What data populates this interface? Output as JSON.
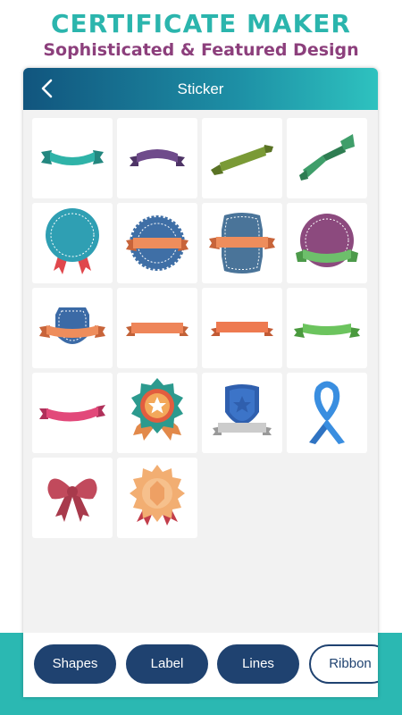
{
  "promo": {
    "title": "CERTIFICATE MAKER",
    "subtitle": "Sophisticated & Featured Design"
  },
  "appbar": {
    "title": "Sticker",
    "back_icon": "chevron-left-icon"
  },
  "stickers": [
    {
      "name": "ribbon-banner-teal-sticker",
      "colors": [
        "#2fb3a8"
      ]
    },
    {
      "name": "ribbon-banner-purple-sticker",
      "colors": [
        "#6f4b8b"
      ]
    },
    {
      "name": "ribbon-banner-olive-sticker",
      "colors": [
        "#7a9a36"
      ]
    },
    {
      "name": "ribbon-zigzag-green-sticker",
      "colors": [
        "#3f9e6a"
      ]
    },
    {
      "name": "badge-teal-ribbon-sticker",
      "colors": [
        "#2f9fb3",
        "#e0474c"
      ]
    },
    {
      "name": "seal-blue-orange-banner-sticker",
      "colors": [
        "#3f6fa6",
        "#ee8d5c"
      ]
    },
    {
      "name": "label-slate-orange-banner-sticker",
      "colors": [
        "#4a7499",
        "#ee8d5c"
      ]
    },
    {
      "name": "circle-purple-green-banner-sticker",
      "colors": [
        "#8c4a7e",
        "#6dbf6b"
      ]
    },
    {
      "name": "shield-blue-orange-banner-sticker",
      "colors": [
        "#3b6aa6",
        "#ee8d5c"
      ]
    },
    {
      "name": "ribbon-banner-orange-sticker",
      "colors": [
        "#ee8559"
      ]
    },
    {
      "name": "ribbon-banner-coral-sticker",
      "colors": [
        "#ee7a50"
      ]
    },
    {
      "name": "ribbon-banner-lightgreen-sticker",
      "colors": [
        "#6cc45e"
      ]
    },
    {
      "name": "ribbon-banner-pink-sticker",
      "colors": [
        "#e2497a"
      ]
    },
    {
      "name": "star-medal-sticker",
      "colors": [
        "#2c9a8e",
        "#e25d3f",
        "#f3a85a"
      ]
    },
    {
      "name": "shield-star-banner-sticker",
      "colors": [
        "#2f5fae",
        "#cccccc"
      ]
    },
    {
      "name": "awareness-ribbon-blue-sticker",
      "colors": [
        "#3a8ee0"
      ]
    },
    {
      "name": "bow-red-sticker",
      "colors": [
        "#c14a5c"
      ]
    },
    {
      "name": "rosette-peach-sticker",
      "colors": [
        "#f2ae72",
        "#c23d4a"
      ]
    }
  ],
  "tabs": [
    {
      "label": "Shapes",
      "active": false
    },
    {
      "label": "Label",
      "active": false
    },
    {
      "label": "Lines",
      "active": false
    },
    {
      "label": "Ribbon",
      "active": true
    }
  ],
  "colors": {
    "accent_teal": "#2bb5ad",
    "subtitle_purple": "#8c3f7c",
    "navy": "#1f4270"
  }
}
